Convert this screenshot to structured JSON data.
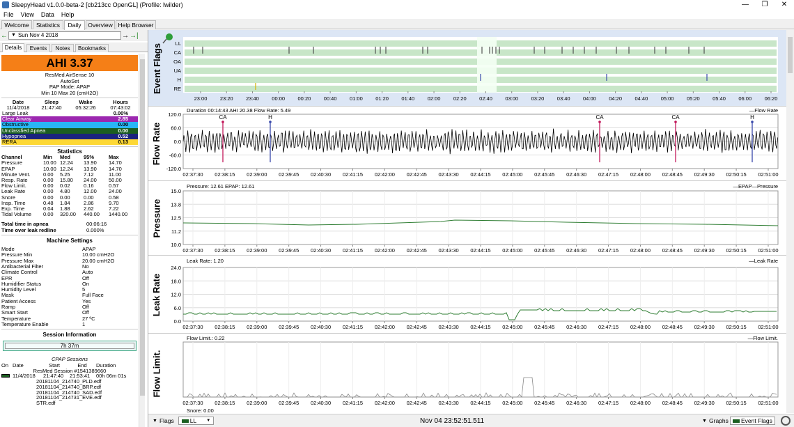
{
  "window": {
    "title": "SleepyHead v1.0.0-beta-2 [cb213cc OpenGL] (Profile: lwilder)",
    "controls": [
      "—",
      "❐",
      "✕"
    ]
  },
  "menu": [
    "File",
    "View",
    "Data",
    "Help"
  ],
  "tabs": [
    "Welcome",
    "Statistics",
    "Daily",
    "Overview",
    "Help Browser"
  ],
  "date": {
    "value": "Sun Nov 4 2018"
  },
  "subtabs": [
    "Details",
    "Events",
    "Notes",
    "Bookmarks"
  ],
  "summary": {
    "ahi": "AHI 3.37",
    "machine": "ResMed AirSense 10",
    "model": "AutoSet",
    "mode": "PAP Mode: APAP",
    "range": "Min 10 Max 20 (cmH2O)"
  },
  "times": {
    "headers": [
      "Date",
      "Sleep",
      "Wake",
      "Hours"
    ],
    "values": [
      "11/4/2018",
      "21:47:40",
      "05:32:26",
      "07:43:02"
    ]
  },
  "events": [
    {
      "name": "Large Leak",
      "value": "0.00%",
      "color": "#ffffff",
      "text": "#000000"
    },
    {
      "name": "Clear Airway",
      "value": "2.85",
      "color": "#9c27b0",
      "text": "#ffffff"
    },
    {
      "name": "Obstructive",
      "value": "0.00",
      "color": "#29b6f6",
      "text": "#000000"
    },
    {
      "name": "Unclassfied Apnea",
      "value": "0.00",
      "color": "#1b5e20",
      "text": "#ffffff"
    },
    {
      "name": "Hypopnea",
      "value": "0.52",
      "color": "#1a237e",
      "text": "#ffffff"
    },
    {
      "name": "RERA",
      "value": "0.13",
      "color": "#fdd835",
      "text": "#000000"
    }
  ],
  "statistics": {
    "title": "Statistics",
    "headers": [
      "Channel",
      "Min",
      "Med",
      "95%",
      "Max"
    ],
    "rows": [
      [
        "Pressure",
        "10.00",
        "12.24",
        "13.90",
        "14.70"
      ],
      [
        "EPAP",
        "10.00",
        "12.24",
        "13.90",
        "14.70"
      ],
      [
        "Minute Vent.",
        "0.00",
        "5.25",
        "7.12",
        "11.00"
      ],
      [
        "Resp. Rate",
        "0.00",
        "15.80",
        "24.00",
        "50.00"
      ],
      [
        "Flow Limit.",
        "0.00",
        "0.02",
        "0.16",
        "0.57"
      ],
      [
        "Leak Rate",
        "0.00",
        "4.80",
        "12.00",
        "24.00"
      ],
      [
        "Snore",
        "0.00",
        "0.00",
        "0.00",
        "0.58"
      ],
      [
        "Insp. Time",
        "0.48",
        "1.84",
        "2.86",
        "9.70"
      ],
      [
        "Exp. Time",
        "0.04",
        "1.88",
        "2.62",
        "7.22"
      ],
      [
        "Tidal Volume",
        "0.00",
        "320.00",
        "440.00",
        "1440.00"
      ]
    ]
  },
  "apnea": [
    [
      "Total time in apnea",
      "00:06:16"
    ],
    [
      "Time over leak redline",
      "0.000%"
    ]
  ],
  "machine_settings": {
    "title": "Machine Settings",
    "rows": [
      [
        "Mode",
        "APAP"
      ],
      [
        "Pressure Min",
        "10.00 cmH2O"
      ],
      [
        "Pressure Max",
        "20.00 cmH2O"
      ],
      [
        "Antibacterial Filter",
        "No"
      ],
      [
        "Climate Control",
        "Auto"
      ],
      [
        "EPR",
        "Off"
      ],
      [
        "Humidifier Status",
        "On"
      ],
      [
        "Humidity Level",
        "5"
      ],
      [
        "Mask",
        "Full Face"
      ],
      [
        "Patient Access",
        "Yes"
      ],
      [
        "Ramp",
        "Off"
      ],
      [
        "Smart Start",
        "Off"
      ],
      [
        "Temperature",
        "27 ºC"
      ],
      [
        "Temperature Enable",
        "1"
      ]
    ]
  },
  "session": {
    "title": "Session Information",
    "duration": "7h 37m",
    "cpap_title": "CPAP Sessions",
    "headers": [
      "On",
      "Date",
      "Start",
      "End",
      "Duration"
    ],
    "session_id": "ResMed Session #1541389660",
    "row": [
      "11/4/2018",
      "21:47:40",
      "21:53:41",
      "00h 06m 01s"
    ],
    "files": [
      "20181104_214740_PLD.edf",
      "20181104_214740_BRP.edf",
      "20181104_214740_SAD.edf",
      "20181104_214731_EVE.edf",
      "STR.edf"
    ]
  },
  "graphs": {
    "event_flags": {
      "label": "Event Flags",
      "rows": [
        "LL",
        "CA",
        "OA",
        "UA",
        "H",
        "RE"
      ],
      "times": [
        "23:00",
        "23:20",
        "23:40",
        "00:00",
        "00:20",
        "00:40",
        "01:00",
        "01:20",
        "01:40",
        "02:00",
        "02:20",
        "02:40",
        "03:00",
        "03:20",
        "03:40",
        "04:00",
        "04:20",
        "04:40",
        "05:00",
        "05:20",
        "05:40",
        "06:00",
        "06:20"
      ]
    },
    "flow_rate": {
      "label": "Flow Rate",
      "info": "Duration 00:14:43 AHI 20.38 Flow Rate: 5.49",
      "legend": "Flow Rate",
      "yticks": [
        "120.0",
        "60.0",
        "0.0",
        "-60.0",
        "-120.0"
      ],
      "markers": [
        "CA",
        "H",
        "CA",
        "CA",
        "H"
      ]
    },
    "pressure": {
      "label": "Pressure",
      "info": "Pressure: 12.61 EPAP: 12.61",
      "legend_a": "EPAP",
      "legend_b": "Pressure",
      "yticks": [
        "15.0",
        "13.8",
        "12.5",
        "11.2",
        "10.0"
      ]
    },
    "leak_rate": {
      "label": "Leak Rate",
      "info": "Leak Rate: 1.20",
      "legend": "Leak Rate",
      "yticks": [
        "24.0",
        "18.0",
        "12.0",
        "6.0",
        "0.0"
      ]
    },
    "flow_limit": {
      "label": "Flow Limit.",
      "info": "Flow Limit.: 0.22",
      "legend": "Flow Limit."
    },
    "xticks": [
      "02:37:30",
      "02:38:15",
      "02:39:00",
      "02:39:45",
      "02:40:30",
      "02:41:15",
      "02:42:00",
      "02:42:45",
      "02:43:30",
      "02:44:15",
      "02:45:00",
      "02:45:45",
      "02:46:30",
      "02:47:15",
      "02:48:00",
      "02:48:45",
      "02:49:30",
      "02:50:15",
      "02:51:00"
    ],
    "snore_partial": "Snore: 0.00"
  },
  "statusbar": {
    "flags_label": "Flags",
    "flag_select": "LL",
    "time": "Nov 04 23:52:51.511",
    "graphs_label": "Graphs",
    "graph_select": "Event Flags"
  },
  "colors": {
    "orange": "#f57f17",
    "flag_band": "#c8e6c8",
    "flow": "#000000",
    "pressure": "#2e7d32",
    "leak": "#2e7d32",
    "flowlimit": "#888888"
  }
}
